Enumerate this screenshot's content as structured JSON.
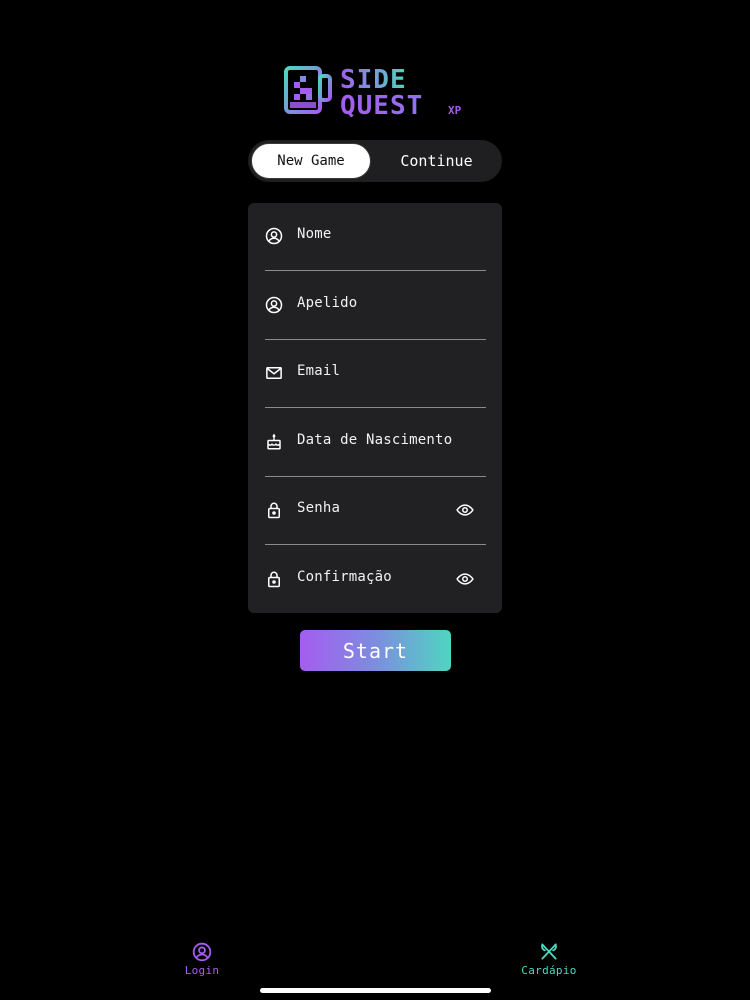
{
  "logo": {
    "word_top": "SIDE",
    "word_bottom": "QUEST",
    "suffix": "XP"
  },
  "auth_mode": {
    "selected": "New Game",
    "new_game_label": "New Game",
    "continue_label": "Continue"
  },
  "form": {
    "fields": [
      {
        "label": "Nome",
        "icon": "user-circle-icon"
      },
      {
        "label": "Apelido",
        "icon": "user-circle-icon"
      },
      {
        "label": "Email",
        "icon": "mail-icon"
      },
      {
        "label": "Data de Nascimento",
        "icon": "cake-icon"
      },
      {
        "label": "Senha",
        "icon": "lock-icon",
        "toggle_icon": "eye-icon"
      },
      {
        "label": "Confirmação",
        "icon": "lock-icon",
        "toggle_icon": "eye-icon"
      }
    ],
    "submit_label": "Start"
  },
  "tab_bar": {
    "items": [
      {
        "label": "Login",
        "icon": "user-circle-icon",
        "color": "#a55cf0"
      },
      {
        "label": "Cardápio",
        "icon": "fork-knife-icon",
        "color": "#4ed6c0"
      }
    ]
  },
  "colors": {
    "background": "#000000",
    "card": "#212023",
    "accent_purple": "#a55cf0",
    "accent_teal": "#4ed6c0"
  }
}
